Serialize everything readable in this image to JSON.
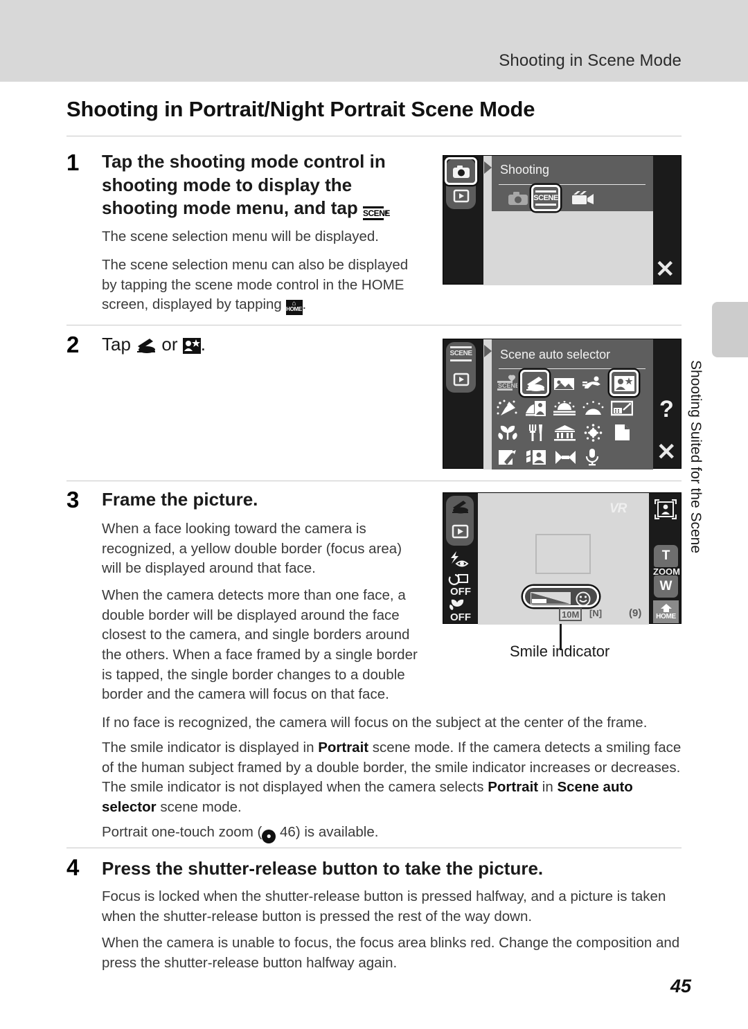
{
  "header": {
    "running_head": "Shooting in Scene Mode"
  },
  "chapter_tab": {
    "label": "Shooting Suited for the Scene"
  },
  "title": "Shooting in Portrait/Night Portrait Scene Mode",
  "page_number": "45",
  "steps": [
    {
      "number": "1",
      "heading_part1": "Tap the shooting mode control in shooting mode to display the shooting mode menu, and tap",
      "heading_icon": "SCENE",
      "heading_part2": ".",
      "paragraphs": [
        "The scene selection menu will be displayed.",
        "The scene selection menu can also be displayed by tapping the scene mode control in the HOME screen, displayed by tapping"
      ],
      "paragraph2_icon": "HOME",
      "paragraph2_tail": "."
    },
    {
      "number": "2",
      "heading_pre": "Tap",
      "heading_mid": "or",
      "heading_post": ".",
      "icon1": "portrait-icon",
      "icon2": "night-portrait-icon"
    },
    {
      "number": "3",
      "heading": "Frame the picture.",
      "paragraphs": [
        "When a face looking toward the camera is recognized, a yellow double border (focus area) will be displayed around that face.",
        "When the camera detects more than one face, a double border will be displayed around the face closest to the camera, and single borders around the others. When a face framed by a single border is tapped, the single border changes to a double border and the camera will focus on that face.",
        "If no face is recognized, the camera will focus on the subject at the center of the frame."
      ],
      "smile_paragraph": {
        "seg1": "The smile indicator is displayed in ",
        "bold1": "Portrait",
        "seg2": " scene mode. If the camera detects a smiling face of the human subject framed by a double border, the smile indicator increases or decreases. The smile indicator is not displayed when the camera selects ",
        "bold2": "Portrait",
        "seg3": " in ",
        "bold3": "Scene auto selector",
        "seg4": " scene mode."
      },
      "zoom_paragraph": {
        "pre": "Portrait one-touch zoom (",
        "ref_icon": "book-ref-icon",
        "ref_page": "46",
        "post": ") is available."
      }
    },
    {
      "number": "4",
      "heading": "Press the shutter-release button to take the picture.",
      "paragraphs": [
        "Focus is locked when the shutter-release button is pressed halfway, and a picture is taken when the shutter-release button is pressed the rest of the way down.",
        "When the camera is unable to focus, the focus area blinks red. Change the composition and press the shutter-release button halfway again."
      ]
    }
  ],
  "screen1": {
    "menu_title": "Shooting",
    "side_buttons": [
      "camera-mode-icon",
      "playback-icon"
    ],
    "mode_items": [
      "auto-camera-icon",
      "SCENE",
      "movie-icon"
    ],
    "selected_mode": "SCENE",
    "close_label": "✕"
  },
  "screen2": {
    "menu_title": "Scene auto selector",
    "side_buttons": [
      "scene-mode-icon",
      "playback-icon"
    ],
    "help_label": "?",
    "close_label": "✕",
    "grid": [
      [
        "scene-auto-selector-icon",
        "portrait-icon",
        "landscape-icon",
        "sports-icon",
        "night-portrait-icon"
      ],
      [
        "party-indoor-icon",
        "beach-snow-icon",
        "sunset-icon",
        "dusk-dawn-icon",
        "night-landscape-icon"
      ],
      [
        "close-up-icon",
        "food-icon",
        "museum-icon",
        "fireworks-icon",
        "copy-icon"
      ],
      [
        "backlight-icon",
        "panorama-assist-icon",
        "pet-portrait-icon",
        "voice-recording-icon"
      ]
    ],
    "selected": [
      "portrait-icon",
      "night-portrait-icon"
    ]
  },
  "screen3": {
    "vr_label": "VR",
    "left_icons": [
      "portrait-mode-icon",
      "playback-icon",
      "flash-red-eye-icon",
      "self-timer-off-icon",
      "macro-off-icon"
    ],
    "right_icons": [
      "face-detect-icon",
      "zoom-tele-icon",
      "zoom-wide-icon",
      "home-icon"
    ],
    "zoom_tele_label": "T",
    "zoom_label": "ZOOM",
    "zoom_wide_label": "W",
    "home_label": "HOME",
    "status_image_size": "10M",
    "status_image_quality": "N",
    "status_shots_remaining": "9",
    "smile_icon": "smile-face-icon",
    "callout": "Smile indicator"
  }
}
